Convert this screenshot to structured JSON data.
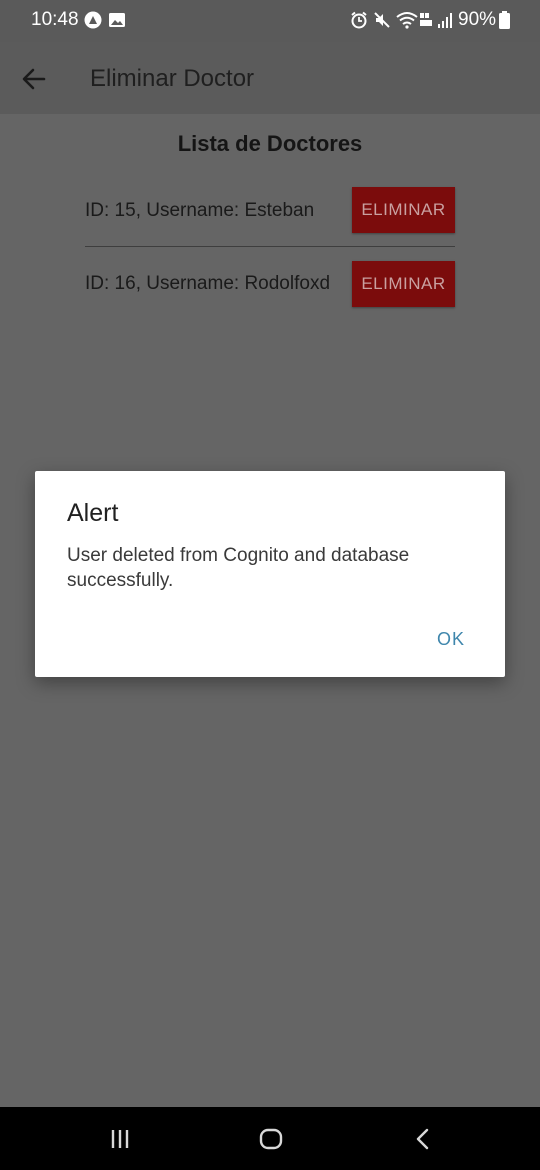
{
  "status_bar": {
    "time": "10:48",
    "battery": "90%",
    "icons": [
      "app-notification-icon",
      "image-notification-icon",
      "alarm-icon",
      "mute-icon",
      "wifi-icon",
      "volte-icon",
      "signal-icon",
      "battery-icon"
    ]
  },
  "app_bar": {
    "title": "Eliminar Doctor",
    "back_icon": "arrow-left-icon"
  },
  "list": {
    "title": "Lista de Doctores",
    "items": [
      {
        "text": "ID: 15,   Username: Esteban",
        "button_label": "ELIMINAR"
      },
      {
        "text": "ID: 16, Username: Rodolfoxd",
        "button_label": "ELIMINAR"
      }
    ]
  },
  "dialog": {
    "title": "Alert",
    "message": "User deleted from Cognito and database successfully.",
    "ok_label": "OK"
  },
  "nav_bar": {
    "icons": [
      "recent-apps-icon",
      "home-icon",
      "back-icon"
    ]
  },
  "colors": {
    "scrim_background": "#656565",
    "delete_button": "#7b0c0c",
    "dialog_accent": "#3f86ac"
  }
}
